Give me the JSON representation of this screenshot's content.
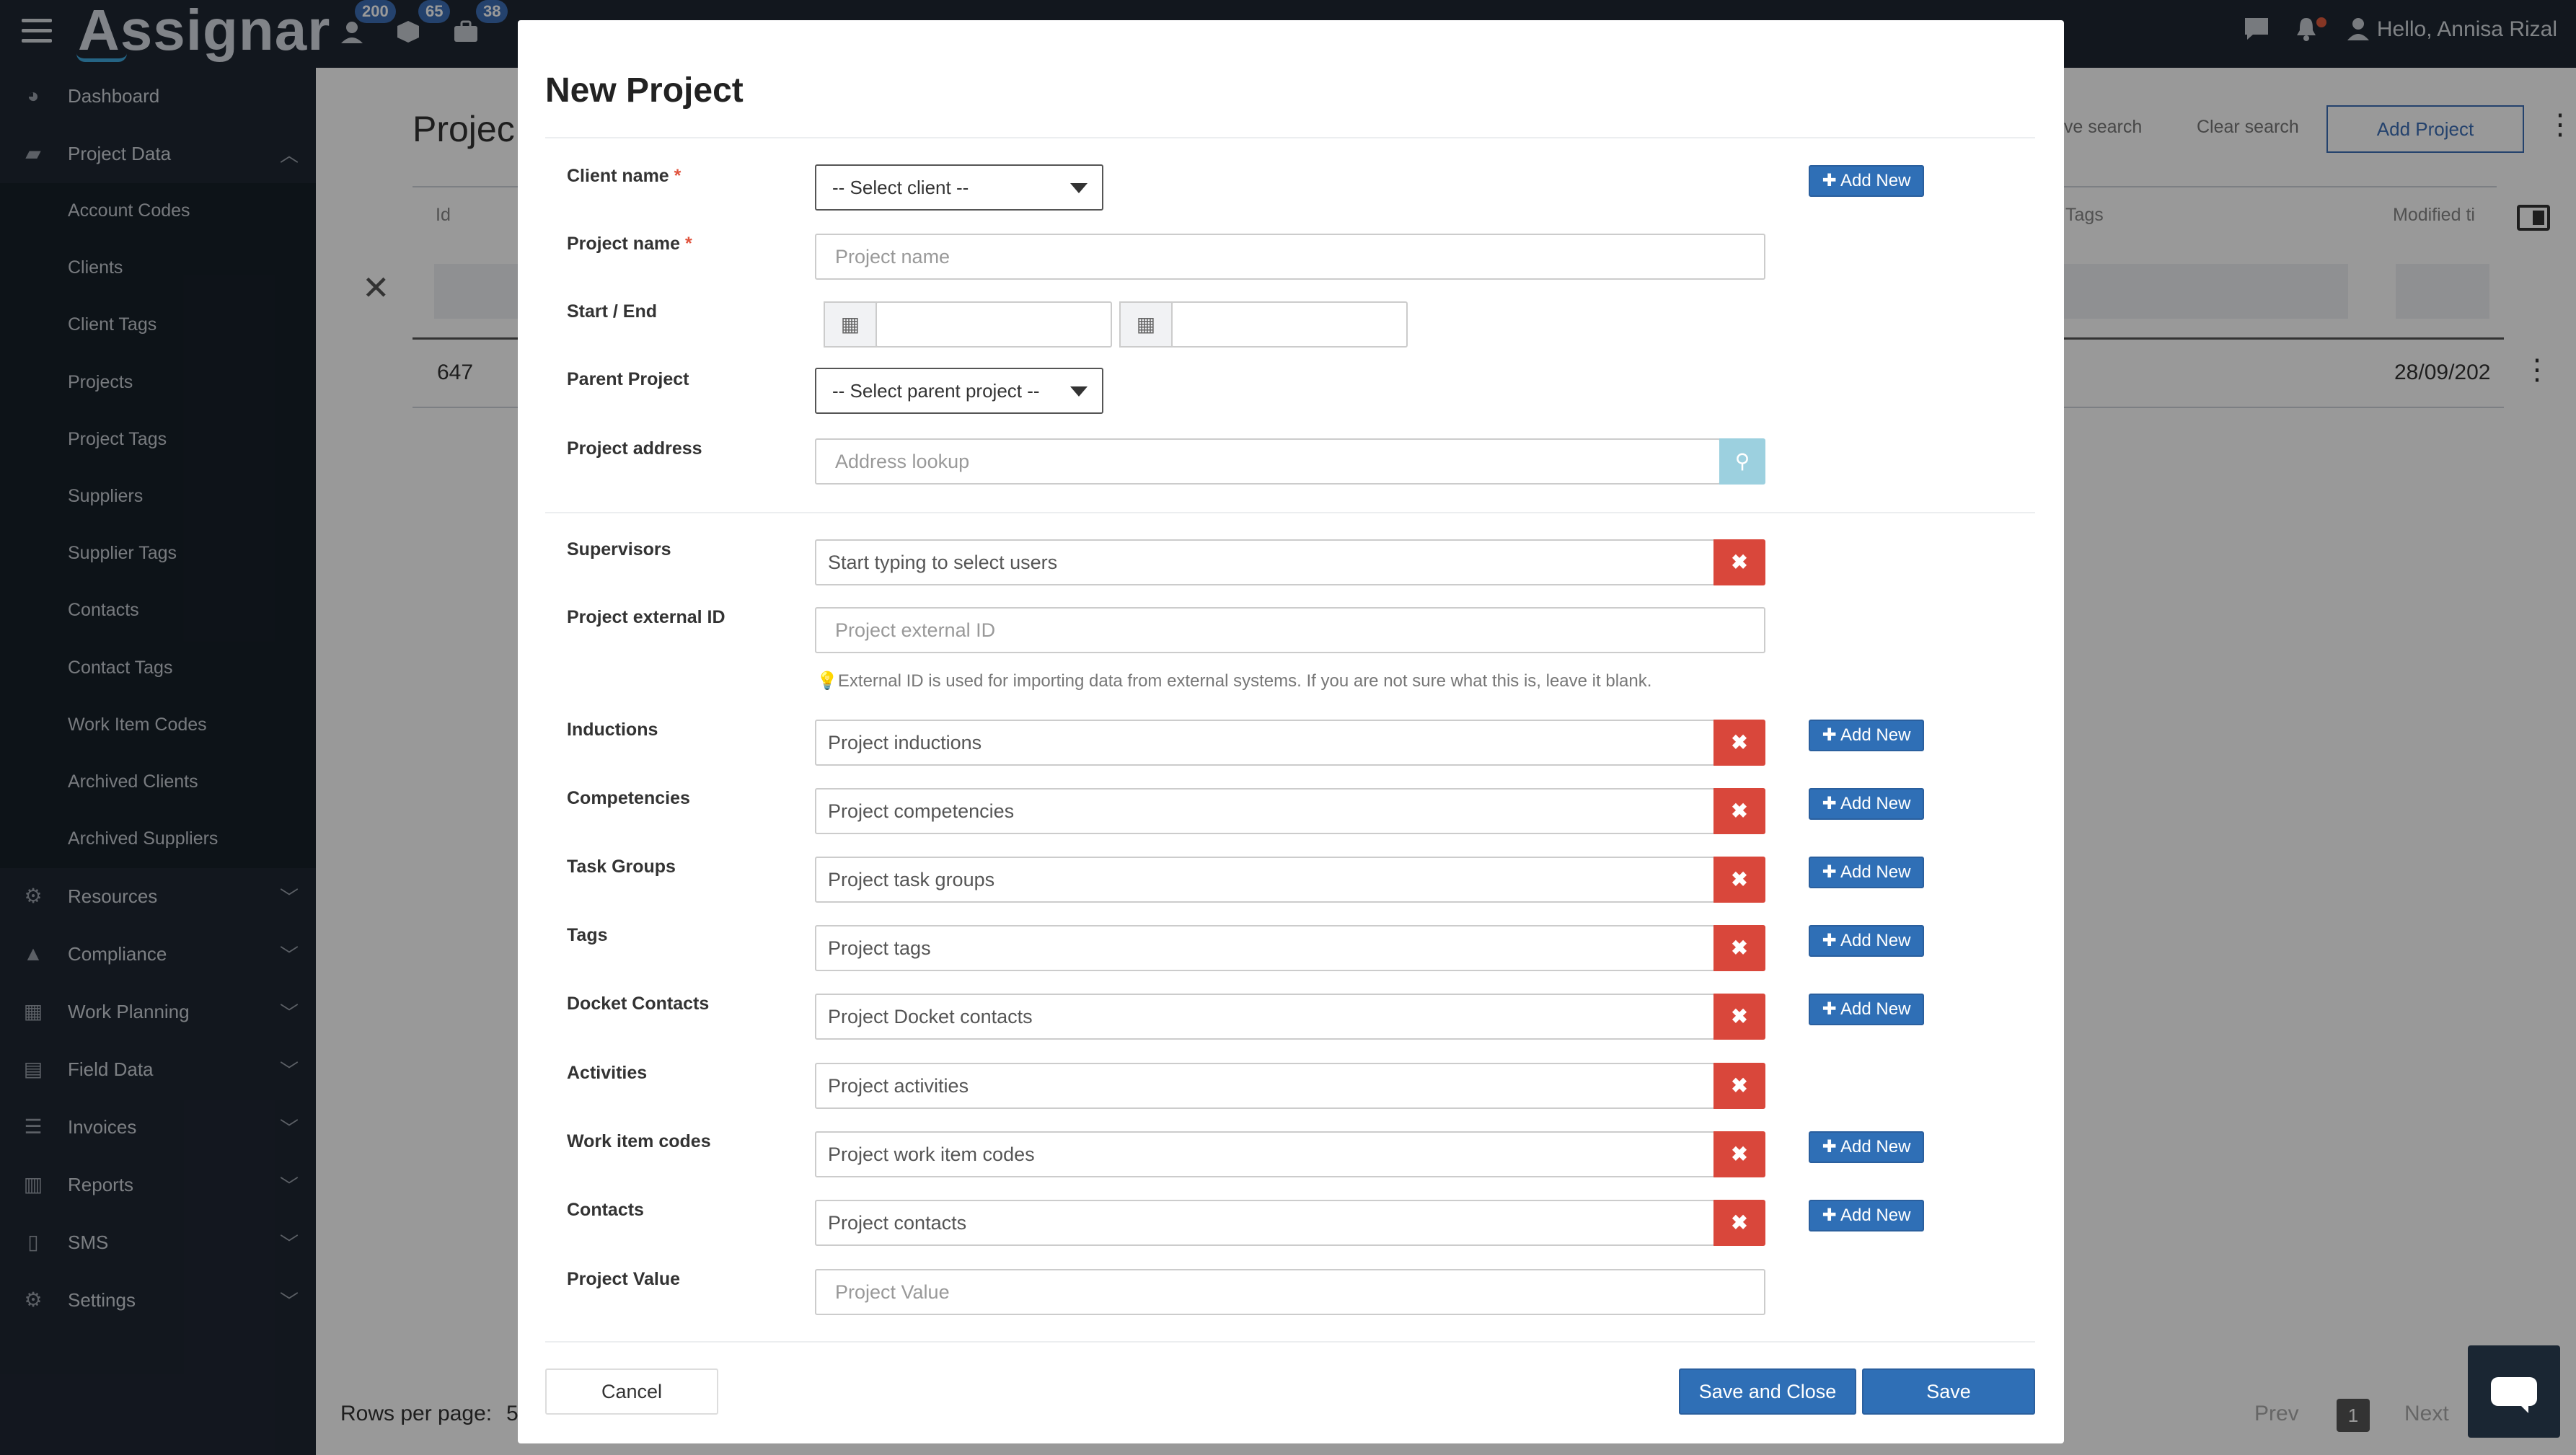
{
  "app": {
    "logo": "Assignar",
    "greeting": "Hello, Annisa Rizal",
    "badges": {
      "users": "200",
      "items": "65",
      "jobs": "38"
    }
  },
  "sidebar": {
    "dashboard": "Dashboard",
    "project_data": "Project Data",
    "sub_items": [
      "Account Codes",
      "Clients",
      "Client Tags",
      "Projects",
      "Project Tags",
      "Suppliers",
      "Supplier Tags",
      "Contacts",
      "Contact Tags",
      "Work Item Codes",
      "Archived Clients",
      "Archived Suppliers"
    ],
    "sections": [
      "Resources",
      "Compliance",
      "Work Planning",
      "Field Data",
      "Invoices",
      "Reports",
      "SMS",
      "Settings"
    ]
  },
  "background": {
    "page_title": "Projec",
    "save_search": "ave search",
    "clear_search": "Clear search",
    "add_project": "Add Project",
    "col_id": "Id",
    "col_tags": "Tags",
    "col_modified": "Modified ti",
    "row_id": "647",
    "row_modified": "28/09/202",
    "rows_per_page": "Rows per page:",
    "rows_value": "5",
    "prev": "Prev",
    "page": "1",
    "next": "Next"
  },
  "modal": {
    "title": "New Project",
    "labels": {
      "client_name": "Client name",
      "project_name": "Project name",
      "start_end": "Start / End",
      "parent_project": "Parent Project",
      "project_address": "Project address",
      "supervisors": "Supervisors",
      "external_id": "Project external ID",
      "inductions": "Inductions",
      "competencies": "Competencies",
      "task_groups": "Task Groups",
      "tags": "Tags",
      "docket_contacts": "Docket Contacts",
      "activities": "Activities",
      "work_item_codes": "Work item codes",
      "contacts": "Contacts",
      "project_value": "Project Value"
    },
    "required_mark": "*",
    "select_client": "-- Select client --",
    "select_parent": "-- Select parent project --",
    "placeholders": {
      "project_name": "Project name",
      "address": "Address lookup",
      "supervisors": "Start typing to select users",
      "external_id": "Project external ID",
      "inductions": "Project inductions",
      "competencies": "Project competencies",
      "task_groups": "Project task groups",
      "tags": "Project tags",
      "docket_contacts": "Project Docket contacts",
      "activities": "Project activities",
      "work_item_codes": "Project work item codes",
      "contacts": "Project contacts",
      "project_value": "Project Value"
    },
    "external_help": "External ID is used for importing data from external systems. If you are not sure what this is, leave it blank.",
    "add_new": "Add New",
    "cancel": "Cancel",
    "save_close": "Save and Close",
    "save": "Save"
  },
  "colors": {
    "nav_bg": "#1f2733",
    "primary": "#2f6fb6",
    "danger": "#d9473b"
  }
}
